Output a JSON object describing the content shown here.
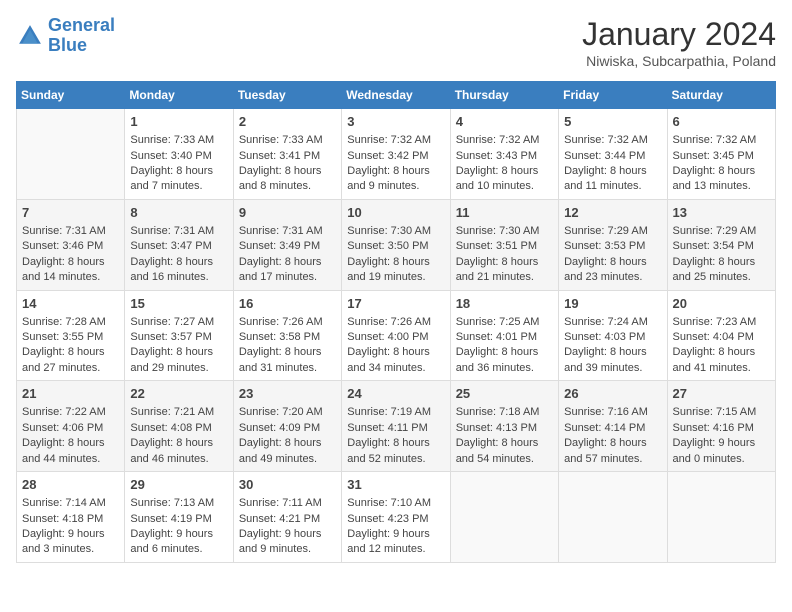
{
  "logo": {
    "line1": "General",
    "line2": "Blue"
  },
  "title": "January 2024",
  "subtitle": "Niwiska, Subcarpathia, Poland",
  "days_of_week": [
    "Sunday",
    "Monday",
    "Tuesday",
    "Wednesday",
    "Thursday",
    "Friday",
    "Saturday"
  ],
  "weeks": [
    [
      {
        "day": "",
        "sunrise": "",
        "sunset": "",
        "daylight": ""
      },
      {
        "day": "1",
        "sunrise": "Sunrise: 7:33 AM",
        "sunset": "Sunset: 3:40 PM",
        "daylight": "Daylight: 8 hours and 7 minutes."
      },
      {
        "day": "2",
        "sunrise": "Sunrise: 7:33 AM",
        "sunset": "Sunset: 3:41 PM",
        "daylight": "Daylight: 8 hours and 8 minutes."
      },
      {
        "day": "3",
        "sunrise": "Sunrise: 7:32 AM",
        "sunset": "Sunset: 3:42 PM",
        "daylight": "Daylight: 8 hours and 9 minutes."
      },
      {
        "day": "4",
        "sunrise": "Sunrise: 7:32 AM",
        "sunset": "Sunset: 3:43 PM",
        "daylight": "Daylight: 8 hours and 10 minutes."
      },
      {
        "day": "5",
        "sunrise": "Sunrise: 7:32 AM",
        "sunset": "Sunset: 3:44 PM",
        "daylight": "Daylight: 8 hours and 11 minutes."
      },
      {
        "day": "6",
        "sunrise": "Sunrise: 7:32 AM",
        "sunset": "Sunset: 3:45 PM",
        "daylight": "Daylight: 8 hours and 13 minutes."
      }
    ],
    [
      {
        "day": "7",
        "sunrise": "Sunrise: 7:31 AM",
        "sunset": "Sunset: 3:46 PM",
        "daylight": "Daylight: 8 hours and 14 minutes."
      },
      {
        "day": "8",
        "sunrise": "Sunrise: 7:31 AM",
        "sunset": "Sunset: 3:47 PM",
        "daylight": "Daylight: 8 hours and 16 minutes."
      },
      {
        "day": "9",
        "sunrise": "Sunrise: 7:31 AM",
        "sunset": "Sunset: 3:49 PM",
        "daylight": "Daylight: 8 hours and 17 minutes."
      },
      {
        "day": "10",
        "sunrise": "Sunrise: 7:30 AM",
        "sunset": "Sunset: 3:50 PM",
        "daylight": "Daylight: 8 hours and 19 minutes."
      },
      {
        "day": "11",
        "sunrise": "Sunrise: 7:30 AM",
        "sunset": "Sunset: 3:51 PM",
        "daylight": "Daylight: 8 hours and 21 minutes."
      },
      {
        "day": "12",
        "sunrise": "Sunrise: 7:29 AM",
        "sunset": "Sunset: 3:53 PM",
        "daylight": "Daylight: 8 hours and 23 minutes."
      },
      {
        "day": "13",
        "sunrise": "Sunrise: 7:29 AM",
        "sunset": "Sunset: 3:54 PM",
        "daylight": "Daylight: 8 hours and 25 minutes."
      }
    ],
    [
      {
        "day": "14",
        "sunrise": "Sunrise: 7:28 AM",
        "sunset": "Sunset: 3:55 PM",
        "daylight": "Daylight: 8 hours and 27 minutes."
      },
      {
        "day": "15",
        "sunrise": "Sunrise: 7:27 AM",
        "sunset": "Sunset: 3:57 PM",
        "daylight": "Daylight: 8 hours and 29 minutes."
      },
      {
        "day": "16",
        "sunrise": "Sunrise: 7:26 AM",
        "sunset": "Sunset: 3:58 PM",
        "daylight": "Daylight: 8 hours and 31 minutes."
      },
      {
        "day": "17",
        "sunrise": "Sunrise: 7:26 AM",
        "sunset": "Sunset: 4:00 PM",
        "daylight": "Daylight: 8 hours and 34 minutes."
      },
      {
        "day": "18",
        "sunrise": "Sunrise: 7:25 AM",
        "sunset": "Sunset: 4:01 PM",
        "daylight": "Daylight: 8 hours and 36 minutes."
      },
      {
        "day": "19",
        "sunrise": "Sunrise: 7:24 AM",
        "sunset": "Sunset: 4:03 PM",
        "daylight": "Daylight: 8 hours and 39 minutes."
      },
      {
        "day": "20",
        "sunrise": "Sunrise: 7:23 AM",
        "sunset": "Sunset: 4:04 PM",
        "daylight": "Daylight: 8 hours and 41 minutes."
      }
    ],
    [
      {
        "day": "21",
        "sunrise": "Sunrise: 7:22 AM",
        "sunset": "Sunset: 4:06 PM",
        "daylight": "Daylight: 8 hours and 44 minutes."
      },
      {
        "day": "22",
        "sunrise": "Sunrise: 7:21 AM",
        "sunset": "Sunset: 4:08 PM",
        "daylight": "Daylight: 8 hours and 46 minutes."
      },
      {
        "day": "23",
        "sunrise": "Sunrise: 7:20 AM",
        "sunset": "Sunset: 4:09 PM",
        "daylight": "Daylight: 8 hours and 49 minutes."
      },
      {
        "day": "24",
        "sunrise": "Sunrise: 7:19 AM",
        "sunset": "Sunset: 4:11 PM",
        "daylight": "Daylight: 8 hours and 52 minutes."
      },
      {
        "day": "25",
        "sunrise": "Sunrise: 7:18 AM",
        "sunset": "Sunset: 4:13 PM",
        "daylight": "Daylight: 8 hours and 54 minutes."
      },
      {
        "day": "26",
        "sunrise": "Sunrise: 7:16 AM",
        "sunset": "Sunset: 4:14 PM",
        "daylight": "Daylight: 8 hours and 57 minutes."
      },
      {
        "day": "27",
        "sunrise": "Sunrise: 7:15 AM",
        "sunset": "Sunset: 4:16 PM",
        "daylight": "Daylight: 9 hours and 0 minutes."
      }
    ],
    [
      {
        "day": "28",
        "sunrise": "Sunrise: 7:14 AM",
        "sunset": "Sunset: 4:18 PM",
        "daylight": "Daylight: 9 hours and 3 minutes."
      },
      {
        "day": "29",
        "sunrise": "Sunrise: 7:13 AM",
        "sunset": "Sunset: 4:19 PM",
        "daylight": "Daylight: 9 hours and 6 minutes."
      },
      {
        "day": "30",
        "sunrise": "Sunrise: 7:11 AM",
        "sunset": "Sunset: 4:21 PM",
        "daylight": "Daylight: 9 hours and 9 minutes."
      },
      {
        "day": "31",
        "sunrise": "Sunrise: 7:10 AM",
        "sunset": "Sunset: 4:23 PM",
        "daylight": "Daylight: 9 hours and 12 minutes."
      },
      {
        "day": "",
        "sunrise": "",
        "sunset": "",
        "daylight": ""
      },
      {
        "day": "",
        "sunrise": "",
        "sunset": "",
        "daylight": ""
      },
      {
        "day": "",
        "sunrise": "",
        "sunset": "",
        "daylight": ""
      }
    ]
  ]
}
